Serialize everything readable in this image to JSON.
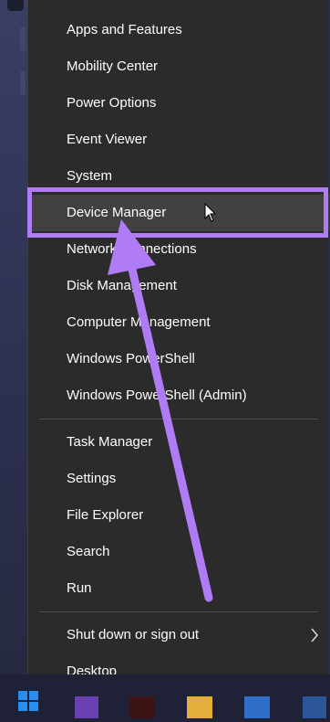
{
  "menu": {
    "group1": [
      {
        "label": "Apps and Features"
      },
      {
        "label": "Mobility Center"
      },
      {
        "label": "Power Options"
      },
      {
        "label": "Event Viewer"
      },
      {
        "label": "System"
      },
      {
        "label": "Device Manager"
      },
      {
        "label": "Network Connections"
      },
      {
        "label": "Disk Management"
      },
      {
        "label": "Computer Management"
      },
      {
        "label": "Windows PowerShell"
      },
      {
        "label": "Windows PowerShell (Admin)"
      }
    ],
    "group2": [
      {
        "label": "Task Manager"
      },
      {
        "label": "Settings"
      },
      {
        "label": "File Explorer"
      },
      {
        "label": "Search"
      },
      {
        "label": "Run"
      }
    ],
    "group3": [
      {
        "label": "Shut down or sign out"
      },
      {
        "label": "Desktop"
      }
    ]
  },
  "highlighted_item": "Device Manager",
  "annotation": {
    "color": "#b07cf6"
  },
  "colors": {
    "menu_bg": "#2b2b2b",
    "hover_bg": "#414141",
    "text": "#ffffff"
  }
}
